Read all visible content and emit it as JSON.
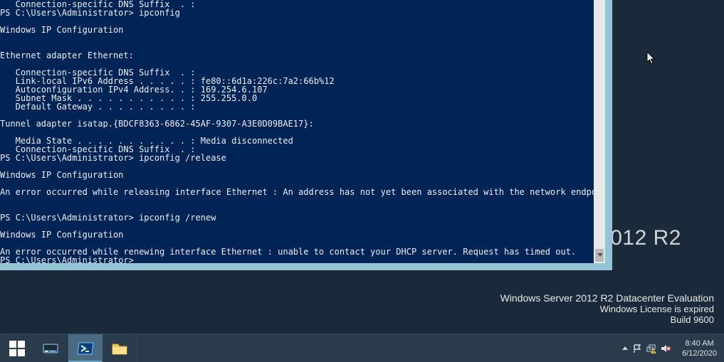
{
  "console": {
    "lines": [
      "   Connection-specific DNS Suffix  . :",
      "PS C:\\Users\\Administrator> ipconfig",
      "",
      "Windows IP Configuration",
      "",
      "",
      "Ethernet adapter Ethernet:",
      "",
      "   Connection-specific DNS Suffix  . :",
      "   Link-local IPv6 Address . . . . . : fe80::6d1a:226c:7a2:66b%12",
      "   Autoconfiguration IPv4 Address. . : 169.254.6.107",
      "   Subnet Mask . . . . . . . . . . . : 255.255.0.0",
      "   Default Gateway . . . . . . . . . :",
      "",
      "Tunnel adapter isatap.{BDCF8363-6862-45AF-9307-A3E0D09BAE17}:",
      "",
      "   Media State . . . . . . . . . . . : Media disconnected",
      "   Connection-specific DNS Suffix  . :",
      "PS C:\\Users\\Administrator> ipconfig /release",
      "",
      "Windows IP Configuration",
      "",
      "An error occurred while releasing interface Ethernet : An address has not yet been associated with the network endpoint.",
      "",
      "",
      "PS C:\\Users\\Administrator> ipconfig /renew",
      "",
      "Windows IP Configuration",
      "",
      "An error occurred while renewing interface Ethernet : unable to contact your DHCP server. Request has timed out.",
      "PS C:\\Users\\Administrator>"
    ]
  },
  "big_version_partial": "012 R2",
  "watermark": {
    "line1": "Windows Server 2012 R2 Datacenter Evaluation",
    "line2": "Windows License is expired",
    "line3": "Build 9600"
  },
  "taskbar": {
    "start_label": "Start",
    "server_manager_label": "Server Manager",
    "powershell_label": "Windows PowerShell",
    "explorer_label": "File Explorer"
  },
  "tray": {
    "time": "8:40 AM",
    "date": "6/12/2020"
  }
}
